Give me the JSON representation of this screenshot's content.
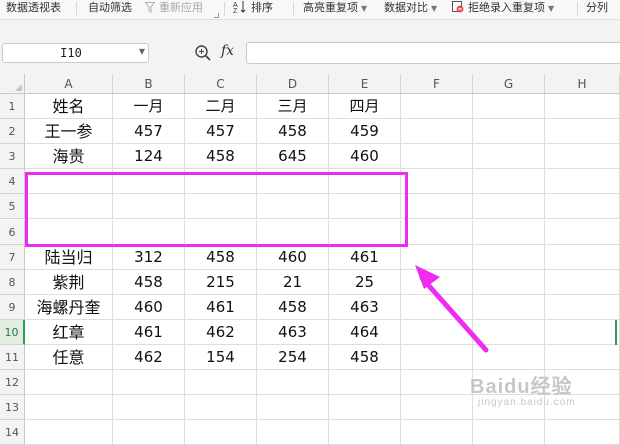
{
  "toolbar": {
    "pivot_label": "数据透视表",
    "autofilter_label": "自动筛选",
    "reapply_label": "重新应用",
    "sort_label": "排序",
    "highlight_dup_label": "高亮重复项",
    "compare_label": "数据对比",
    "reject_dup_label": "拒绝录入重复项",
    "split_label": "分列"
  },
  "namebox": {
    "value": "I10"
  },
  "formula": {
    "fx_label": "fx",
    "value": ""
  },
  "columns": [
    "A",
    "B",
    "C",
    "D",
    "E",
    "F",
    "G",
    "H"
  ],
  "rows": [
    "1",
    "2",
    "3",
    "4",
    "5",
    "6",
    "7",
    "8",
    "9",
    "10",
    "11",
    "12",
    "13",
    "14"
  ],
  "active_row": "10",
  "cells": [
    [
      "姓名",
      "一月",
      "二月",
      "三月",
      "四月"
    ],
    [
      "王一参",
      "457",
      "457",
      "458",
      "459"
    ],
    [
      "海贵",
      "124",
      "458",
      "645",
      "460"
    ],
    [
      "",
      "",
      "",
      "",
      ""
    ],
    [
      "",
      "",
      "",
      "",
      ""
    ],
    [
      "",
      "",
      "",
      "",
      ""
    ],
    [
      "陆当归",
      "312",
      "458",
      "460",
      "461"
    ],
    [
      "紫荆",
      "458",
      "215",
      "21",
      "25"
    ],
    [
      "海螺丹奎",
      "460",
      "461",
      "458",
      "463"
    ],
    [
      "红章",
      "461",
      "462",
      "463",
      "464"
    ],
    [
      "任意",
      "462",
      "154",
      "254",
      "458"
    ]
  ],
  "annotation": {
    "box_color": "#ef2bef",
    "arrow_color": "#ef2bef"
  },
  "watermark": {
    "brand": "Baidu经验",
    "url": "jingyan.baidu.com"
  },
  "colors": {
    "active_green": "#2c9b55",
    "header_bg": "#f3f3f3"
  }
}
